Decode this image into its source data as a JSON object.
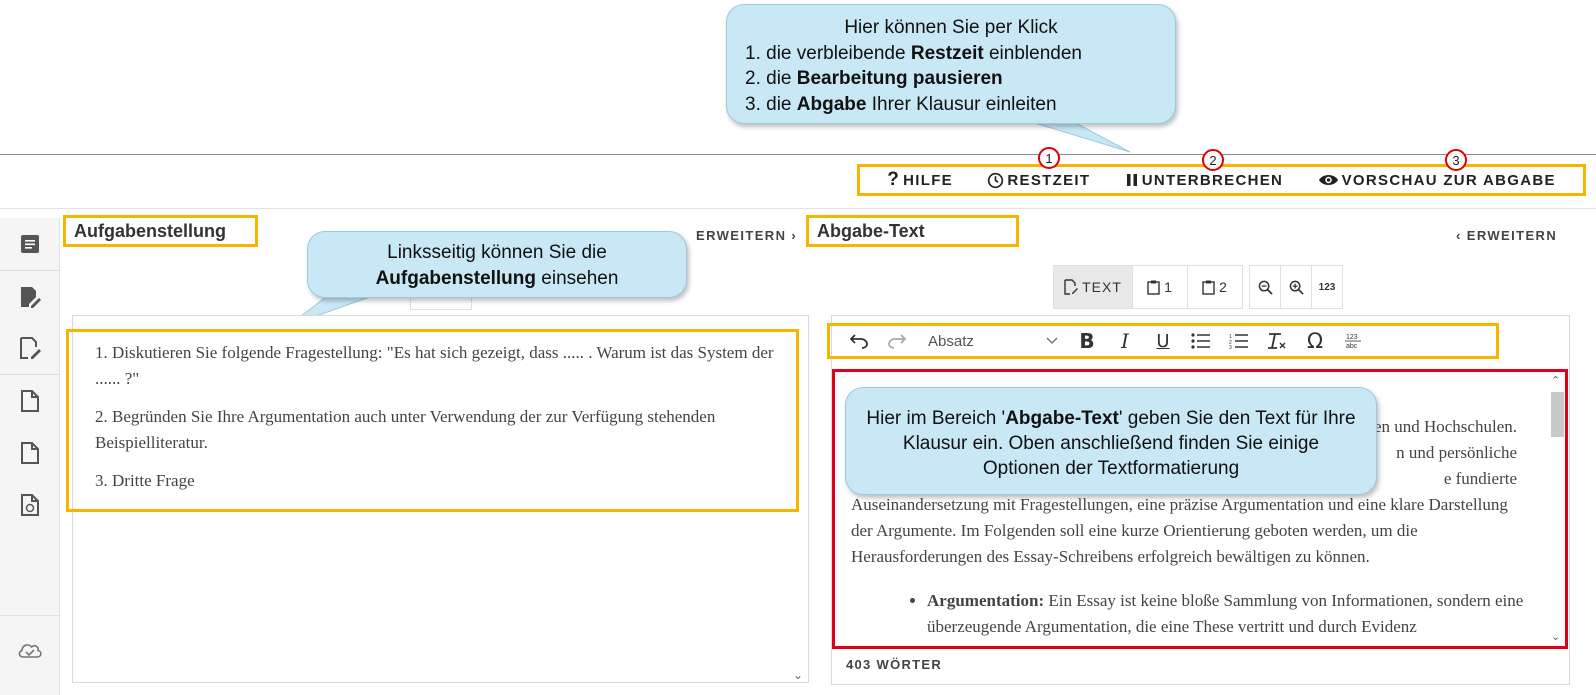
{
  "callouts": {
    "top": {
      "line0": "Hier können Sie per Klick",
      "line1_pre": "1. die verbleibende ",
      "line1_bold": "Restzeit",
      "line1_post": " einblenden",
      "line2_pre": "2. die ",
      "line2_bold": "Bearbeitung pausieren",
      "line3_pre": "3. die ",
      "line3_bold": "Abgabe",
      "line3_post": " Ihrer Klausur einleiten"
    },
    "left": {
      "line1": "Linksseitig können Sie die",
      "line2_bold": "Aufgabenstellung",
      "line2_post": " einsehen"
    },
    "right": {
      "pre": "Hier im Bereich '",
      "bold": "Abgabe-Text",
      "post": "' geben Sie den Text für Ihre Klausur ein. Oben anschließend finden Sie einige Optionen der Textformatierung"
    }
  },
  "markers": [
    "1",
    "2",
    "3"
  ],
  "toolbar": {
    "help_label": "HILFE",
    "time_label": "RESTZEIT",
    "pause_label": "UNTERBRECHEN",
    "preview_label": "VORSCHAU ZUR ABGABE",
    "help_icon": "question-mark-icon",
    "time_icon": "clock-icon",
    "pause_icon": "pause-icon",
    "preview_icon": "eye-icon"
  },
  "sidebar": {
    "icons": [
      "document-list-icon",
      "edit-note-icon",
      "edit-document-icon",
      "file-icon",
      "file-icon",
      "file-code-icon",
      "cloud-check-icon"
    ]
  },
  "left_panel": {
    "title": "Aufgabenstellung",
    "expand_label": "ERWEITERN",
    "tasks": [
      "1. Diskutieren Sie folgende Fragestellung: \"Es hat sich gezeigt, dass ..... . Warum ist das System der ......   ?\"",
      "2. Begründen Sie Ihre Argumentation auch unter Verwendung der zur Verfügung stehenden Beispielliteratur.",
      "3. Dritte Frage"
    ]
  },
  "right_panel": {
    "title": "Abgabe-Text",
    "expand_label": "ERWEITERN",
    "modes": {
      "text": "TEXT",
      "note1": "1",
      "note2": "2",
      "zoom_out": "zoom-out-icon",
      "zoom_in": "zoom-in-icon",
      "count": "123"
    },
    "format": {
      "paragraph_select": "Absatz",
      "icons": [
        "undo-icon",
        "redo-icon",
        "bold-icon",
        "italic-icon",
        "underline-icon",
        "bullet-list-icon",
        "numbered-list-icon",
        "clear-format-icon",
        "omega-icon",
        "spellcheck-icon"
      ]
    },
    "editor": {
      "visible_fragments": [
        "en und Hochschulen.",
        "n und persönliche",
        "e fundierte"
      ],
      "paragraph": "Auseinandersetzung mit Fragestellungen, eine präzise Argumentation und eine klare Darstellung der Argumente. Im Folgenden soll eine kurze Orientierung geboten werden, um die Herausforderungen des Essay-Schreibens erfolgreich bewältigen zu können.",
      "bullet_bold": "Argumentation:",
      "bullet_text": " Ein Essay ist keine bloße Sammlung von Informationen, sondern eine überzeugende Argumentation, die eine These vertritt und durch Evidenz"
    },
    "word_count": "403 WÖRTER"
  },
  "colors": {
    "highlight": "#f7b500",
    "editor_border": "#e0001a",
    "callout_bg": "#c9e8f5"
  }
}
